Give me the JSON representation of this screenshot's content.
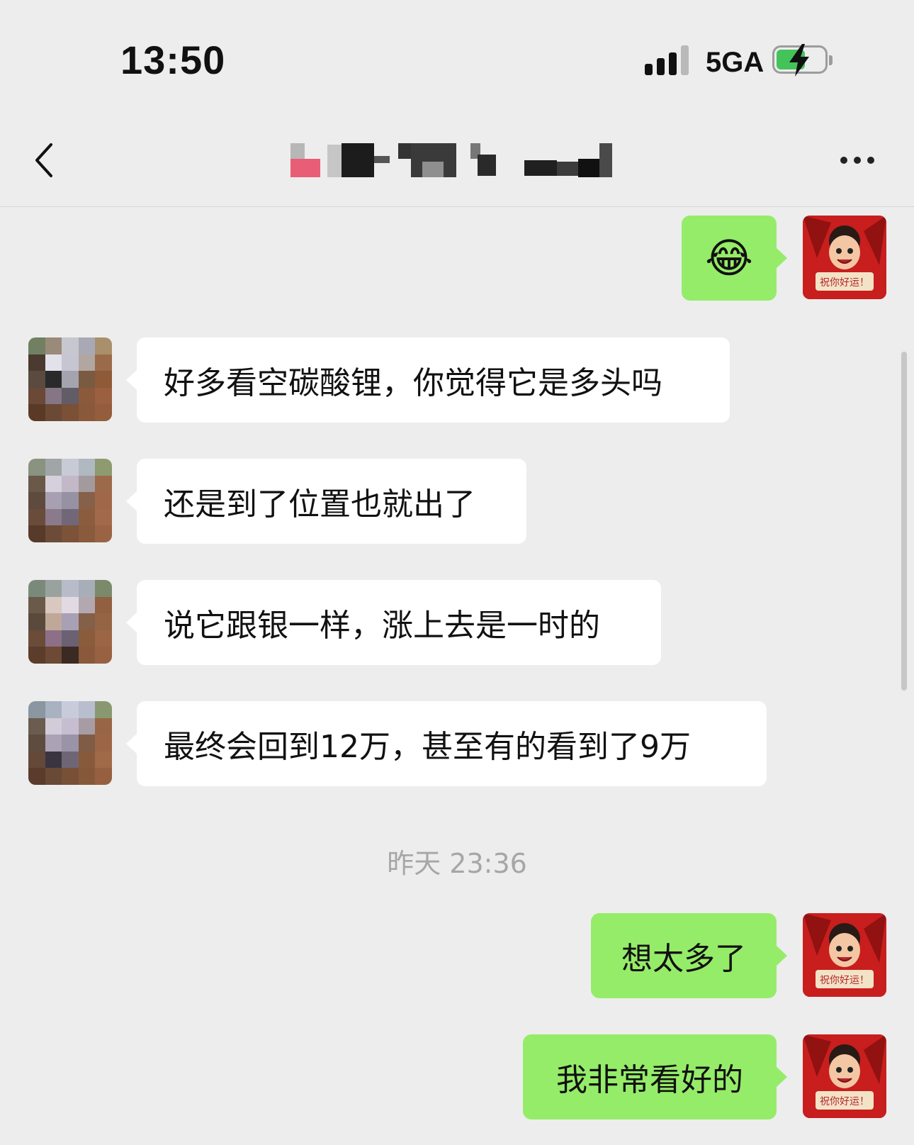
{
  "status_bar": {
    "time": "13:50",
    "network": "5GA",
    "battery_icon": "battery-charging-icon",
    "signal_icon": "signal-strength-icon"
  },
  "nav": {
    "back_icon": "chevron-left-icon",
    "more_icon": "more-dots-icon",
    "title_obscured": true
  },
  "messages": [
    {
      "side": "outgoing",
      "emoji": "😂"
    },
    {
      "side": "incoming",
      "text": "好多看空碳酸锂，你觉得它是多头吗"
    },
    {
      "side": "incoming",
      "text": "还是到了位置也就出了"
    },
    {
      "side": "incoming",
      "text": "说它跟银一样，涨上去是一时的"
    },
    {
      "side": "incoming",
      "text": "最终会回到12万，甚至有的看到了9万"
    },
    {
      "side": "outgoing",
      "text": "想太多了"
    },
    {
      "side": "outgoing",
      "text": "我非常看好的"
    }
  ],
  "timestamp": "昨天 23:36",
  "avatars": {
    "self": {
      "caption": "祝你好运！",
      "color": "#c81e1e"
    },
    "contact": {
      "obscured": true
    }
  },
  "colors": {
    "background": "#ededed",
    "outgoing_bubble": "#95ec69",
    "incoming_bubble": "#ffffff",
    "timestamp_text": "#a6a6a6"
  }
}
